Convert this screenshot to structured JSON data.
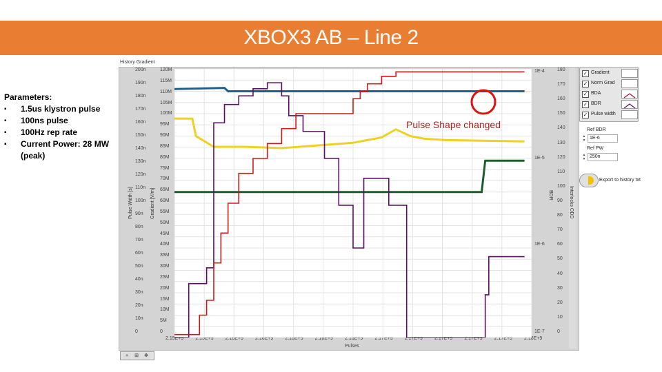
{
  "banner": {
    "title": "XBOX3 AB – Line 2"
  },
  "params": {
    "heading": "Parameters:",
    "items": [
      "1.5us klystron pulse",
      "100ns pulse",
      "100Hz rep rate",
      "Current Power: 28 MW (peak)"
    ]
  },
  "graph": {
    "title": "History Gradient",
    "annotation": "Pulse Shape changed",
    "colors": {
      "gradient": "#1f5f8c",
      "pulse_width": "#f0d020",
      "bdr": "#5a1060",
      "bda": "#d01818",
      "norm_grad": "#1a5e2a",
      "highlight": "#e01010"
    }
  },
  "chart_data": {
    "type": "line",
    "title": "History Gradient",
    "xlabel": "Pulses",
    "x_ticks": [
      "2.15E+9",
      "2.15E+9",
      "2.16E+9",
      "2.16E+9",
      "2.16E+9",
      "2.16E+9",
      "2.16E+9",
      "2.17E+9",
      "2.17E+9",
      "2.17E+9",
      "2.17E+9",
      "2.17E+9",
      "2.18E+9"
    ],
    "axes": {
      "pulse_width": {
        "label": "Pulse Width [s]",
        "ticks": [
          "0",
          "10n",
          "20n",
          "30n",
          "40n",
          "50n",
          "60n",
          "70n",
          "80n",
          "90n",
          "100n",
          "110n",
          "120n",
          "130n",
          "140n",
          "150n",
          "160n",
          "170n",
          "180n",
          "190n",
          "200n"
        ],
        "range": [
          0,
          2e-07
        ]
      },
      "gradient": {
        "label": "Gradient [V/m]",
        "ticks": [
          "0",
          "5M",
          "10M",
          "15M",
          "20M",
          "25M",
          "30M",
          "35M",
          "40M",
          "45M",
          "50M",
          "55M",
          "60M",
          "65M",
          "70M",
          "75M",
          "80M",
          "85M",
          "90M",
          "95M",
          "100M",
          "105M",
          "110M",
          "115M",
          "120M"
        ],
        "range": [
          0,
          120000000
        ]
      },
      "bdr": {
        "label": "BDR",
        "ticks": [
          "1E-7",
          "1E-6",
          "1E-5",
          "1E-4"
        ],
        "scale": "log"
      },
      "bda": {
        "label": "Interlocks ODD",
        "ticks": [
          "0",
          "10",
          "20",
          "30",
          "40",
          "50",
          "60",
          "70",
          "80",
          "90",
          "100",
          "110",
          "120",
          "130",
          "140",
          "150",
          "160",
          "170",
          "180"
        ],
        "range": [
          0,
          180
        ]
      }
    },
    "series": [
      {
        "name": "Gradient",
        "axis": "gradient",
        "x": [
          0,
          0.14,
          0.15,
          0.98
        ],
        "y": [
          111,
          111.5,
          110,
          110
        ]
      },
      {
        "name": "Pulse width",
        "axis": "pulse_width",
        "x": [
          0,
          0.05,
          0.06,
          0.11,
          0.2,
          0.3,
          0.4,
          0.5,
          0.58,
          0.62,
          0.66,
          0.7,
          0.76,
          0.98
        ],
        "y": [
          1.63e-07,
          1.63e-07,
          1.5e-07,
          1.42e-07,
          1.42e-07,
          1.41e-07,
          1.43e-07,
          1.45e-07,
          1.49e-07,
          1.55e-07,
          1.5e-07,
          1.48e-07,
          1.47e-07,
          1.46e-07
        ]
      },
      {
        "name": "Norm Grad",
        "axis": "gradient",
        "x": [
          0,
          0.86,
          0.87,
          0.98
        ],
        "y": [
          65,
          65,
          79,
          79
        ]
      },
      {
        "name": "BDR",
        "axis": "bdr",
        "x": [
          0,
          0.03,
          0.04,
          0.09,
          0.11,
          0.14,
          0.18,
          0.22,
          0.26,
          0.3,
          0.32,
          0.36,
          0.42,
          0.46,
          0.48,
          0.5,
          0.53,
          0.57,
          0.6,
          0.64,
          0.65,
          0.68,
          0.87,
          0.88,
          0.98
        ],
        "y": [
          1e-07,
          1e-07,
          4e-07,
          6e-07,
          2.5e-05,
          4e-05,
          5e-05,
          6e-05,
          7e-05,
          5e-05,
          3e-05,
          2e-05,
          1e-05,
          3e-06,
          3e-06,
          1e-06,
          6e-06,
          6e-06,
          3e-06,
          3e-06,
          1e-07,
          1e-07,
          3e-07,
          8e-07,
          8e-07
        ]
      },
      {
        "name": "BDA",
        "axis": "bda",
        "x": [
          0,
          0.05,
          0.07,
          0.09,
          0.11,
          0.13,
          0.15,
          0.18,
          0.22,
          0.26,
          0.3,
          0.34,
          0.4,
          0.48,
          0.5,
          0.52,
          0.54,
          0.58,
          0.62,
          0.98
        ],
        "y": [
          2,
          2,
          15,
          25,
          50,
          70,
          90,
          110,
          120,
          130,
          140,
          150,
          150,
          150,
          160,
          165,
          170,
          175,
          178,
          178
        ]
      }
    ],
    "legend": [
      "Gradient",
      "Norm Grad",
      "BDA",
      "BDR",
      "Pulse width"
    ],
    "legend_position": "right"
  },
  "legend": {
    "items": [
      {
        "label": "Gradient",
        "checked": true
      },
      {
        "label": "Norm Grad",
        "checked": true
      },
      {
        "label": "BDA",
        "checked": true
      },
      {
        "label": "BDR",
        "checked": true
      },
      {
        "label": "Pulse width",
        "checked": true
      }
    ]
  },
  "controls": {
    "ref_bdr_label": "Ref BDR",
    "ref_bdr_value": "1E-6",
    "ref_pw_label": "Ref PW",
    "ref_pw_value": "250n",
    "export_label": "Export to history txt"
  }
}
